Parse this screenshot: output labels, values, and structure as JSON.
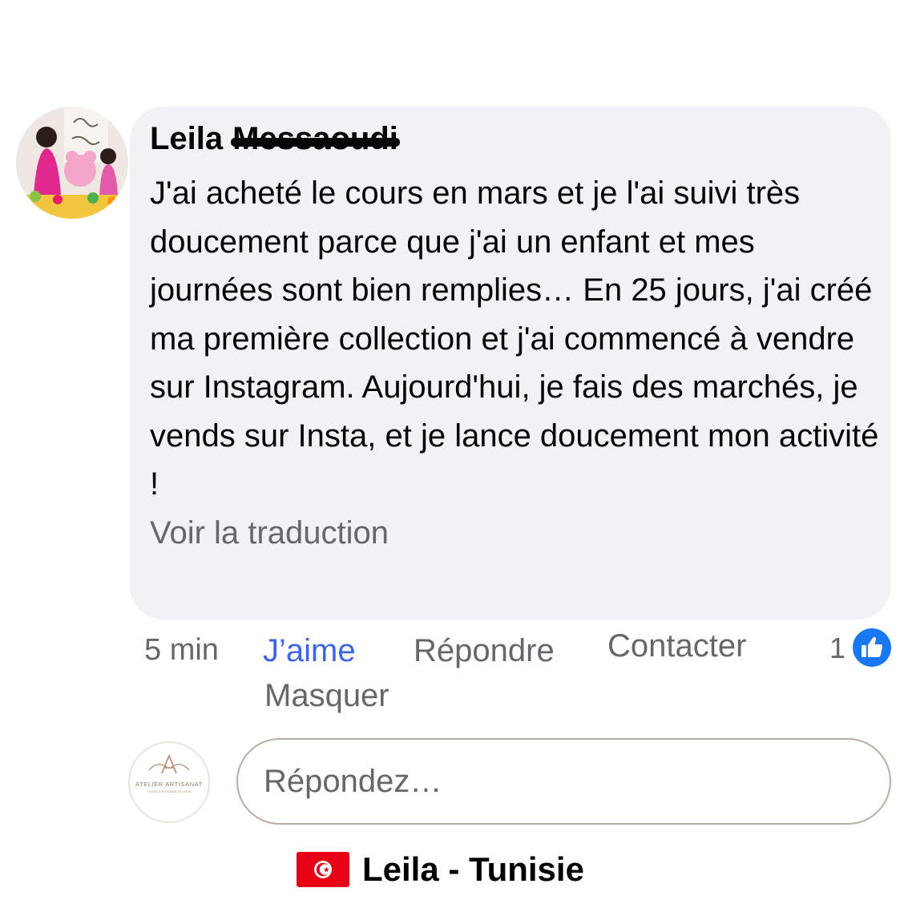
{
  "comment": {
    "author_first": "Leila",
    "author_last": "Messaoudi",
    "text": "J'ai acheté le cours en mars et je l'ai suivi très doucement parce que j'ai un enfant et mes journées sont bien remplies… En 25 jours, j'ai créé ma première collection et j'ai commencé à vendre sur Instagram. Aujourd'hui, je fais des marchés, je vends sur Insta, et je lance doucement mon activité !",
    "translate_link": "Voir la traduction"
  },
  "actions": {
    "time": "5 min",
    "like": "J’aime",
    "reply": "Répondre",
    "contact": "Contacter",
    "hide": "Masquer",
    "reaction_count": "1"
  },
  "reply_box": {
    "placeholder": "Répondez…",
    "logo_title": "ATELIER ARTISANAT",
    "logo_subtitle": "COURS D'ARTISANAT EN LIGNE"
  },
  "caption": {
    "text": "Leila - Tunisie"
  },
  "colors": {
    "bubble": "#f0f2f5",
    "like_blue": "#3b66e8",
    "badge_blue": "#1877f2",
    "muted": "#65676b",
    "flag_red": "#e70013"
  },
  "icons": {
    "like_badge": "thumbs-up-icon",
    "flag": "tunisia-flag-icon"
  }
}
